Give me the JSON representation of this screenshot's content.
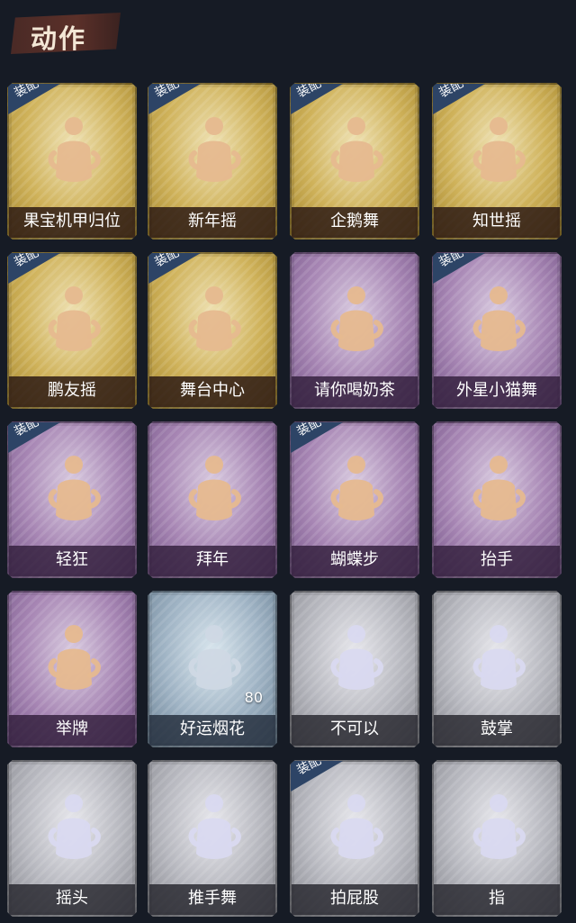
{
  "header": {
    "title": "动作"
  },
  "equip_label": "装配",
  "cards": [
    {
      "label": "果宝机甲归位",
      "rarity": "gold",
      "equipped": true
    },
    {
      "label": "新年摇",
      "rarity": "gold",
      "equipped": true
    },
    {
      "label": "企鹅舞",
      "rarity": "gold",
      "equipped": true
    },
    {
      "label": "知世摇",
      "rarity": "gold",
      "equipped": true
    },
    {
      "label": "鹏友摇",
      "rarity": "gold",
      "equipped": true
    },
    {
      "label": "舞台中心",
      "rarity": "gold",
      "equipped": true
    },
    {
      "label": "请你喝奶茶",
      "rarity": "purple",
      "equipped": false
    },
    {
      "label": "外星小猫舞",
      "rarity": "purple",
      "equipped": true
    },
    {
      "label": "轻狂",
      "rarity": "purple",
      "equipped": true
    },
    {
      "label": "拜年",
      "rarity": "purple",
      "equipped": false
    },
    {
      "label": "蝴蝶步",
      "rarity": "purple",
      "equipped": true
    },
    {
      "label": "抬手",
      "rarity": "purple",
      "equipped": false
    },
    {
      "label": "举牌",
      "rarity": "purple",
      "equipped": false
    },
    {
      "label": "好运烟花",
      "rarity": "blue",
      "equipped": false,
      "count": "80"
    },
    {
      "label": "不可以",
      "rarity": "gray",
      "equipped": false
    },
    {
      "label": "鼓掌",
      "rarity": "gray",
      "equipped": false
    },
    {
      "label": "摇头",
      "rarity": "gray",
      "equipped": false
    },
    {
      "label": "推手舞",
      "rarity": "gray",
      "equipped": false
    },
    {
      "label": "拍屁股",
      "rarity": "gray",
      "equipped": true
    },
    {
      "label": "指",
      "rarity": "gray",
      "equipped": false
    }
  ]
}
